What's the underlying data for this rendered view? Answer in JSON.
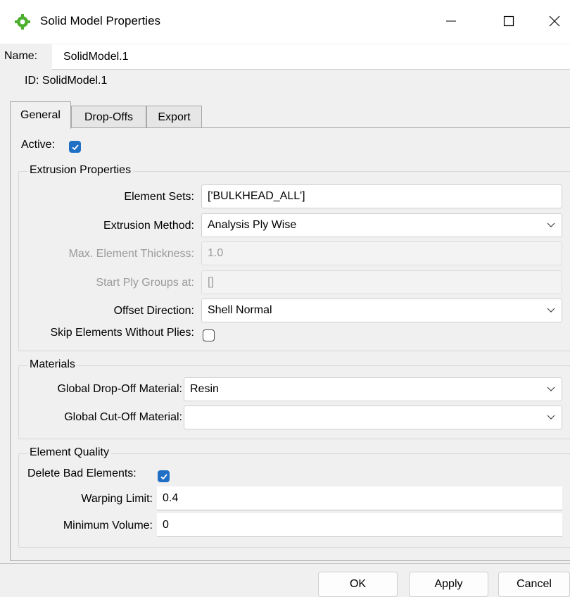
{
  "window": {
    "title": "Solid Model Properties",
    "app_icon": "gear-icon",
    "minimize_icon": "minimize-icon",
    "maximize_icon": "maximize-icon",
    "close_icon": "close-icon"
  },
  "name": {
    "label": "Name:",
    "value": "SolidModel.1"
  },
  "id": {
    "text": "ID: SolidModel.1"
  },
  "tabs": [
    {
      "label": "General",
      "active": true
    },
    {
      "label": "Drop-Offs",
      "active": false
    },
    {
      "label": "Export",
      "active": false
    }
  ],
  "general": {
    "active": {
      "label": "Active:",
      "checked": true
    },
    "extrusion": {
      "title": "Extrusion Properties",
      "element_sets": {
        "label": "Element Sets:",
        "value": "['BULKHEAD_ALL']"
      },
      "extrusion_method": {
        "label": "Extrusion Method:",
        "value": "Analysis Ply Wise"
      },
      "max_thickness": {
        "label": "Max. Element Thickness:",
        "value": "1.0",
        "disabled": true
      },
      "start_ply_groups": {
        "label": "Start Ply Groups at:",
        "value": "[]",
        "disabled": true
      },
      "offset_direction": {
        "label": "Offset Direction:",
        "value": "Shell Normal"
      },
      "skip_elements": {
        "label": "Skip Elements Without Plies:",
        "checked": false
      }
    },
    "materials": {
      "title": "Materials",
      "drop_off": {
        "label": "Global Drop-Off Material:",
        "value": "Resin"
      },
      "cut_off": {
        "label": "Global Cut-Off Material:",
        "value": ""
      }
    },
    "quality": {
      "title": "Element Quality",
      "delete_bad": {
        "label": "Delete Bad Elements:",
        "checked": true
      },
      "warping_limit": {
        "label": "Warping Limit:",
        "value": "0.4"
      },
      "minimum_volume": {
        "label": "Minimum Volume:",
        "value": "0"
      }
    }
  },
  "buttons": {
    "ok": "OK",
    "apply": "Apply",
    "cancel": "Cancel"
  },
  "colors": {
    "checkbox_accent": "#1f6fc5",
    "app_icon_green": "#4caf2e"
  }
}
